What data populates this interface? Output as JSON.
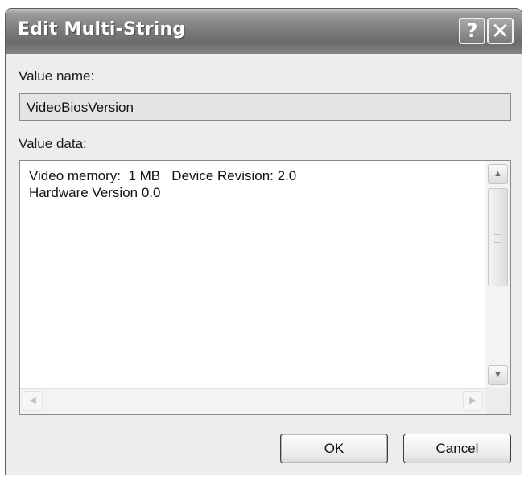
{
  "window": {
    "title": "Edit Multi-String",
    "help_glyph": "?",
    "close_glyph": "✕"
  },
  "value_name": {
    "label": "Value name:",
    "value": "VideoBiosVersion"
  },
  "value_data": {
    "label": "Value data:",
    "lines": [
      "Video memory:  1 MB   Device Revision: 2.0",
      "Hardware Version 0.0"
    ]
  },
  "scrollbars": {
    "up_glyph": "▲",
    "down_glyph": "▼",
    "left_glyph": "◀",
    "right_glyph": "▶"
  },
  "buttons": {
    "ok": "OK",
    "cancel": "Cancel"
  }
}
